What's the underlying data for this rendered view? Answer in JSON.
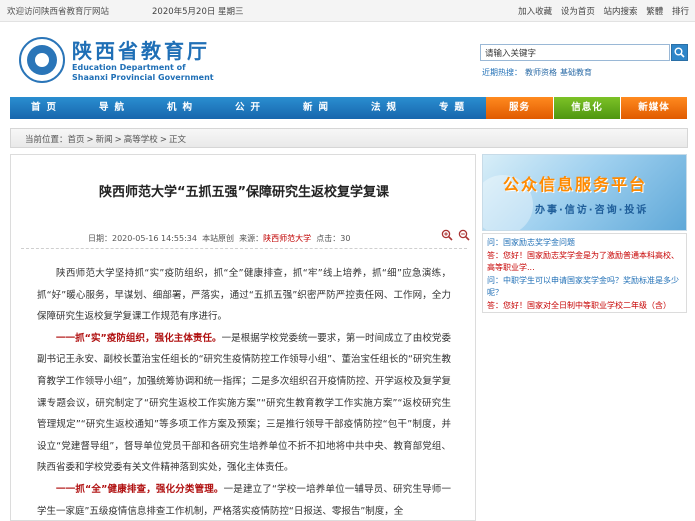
{
  "topbar": {
    "welcome": "欢迎访问陕西省教育厅网站",
    "date": "2020年5月20日 星期三",
    "links": [
      "加入收藏",
      "设为首页",
      "站内搜索",
      "繁體",
      "排行"
    ]
  },
  "header": {
    "title_cn": "陕西省教育厅",
    "title_en_line1": "Education Department of",
    "title_en_line2": "Shaanxi Provincial Government",
    "search_placeholder": "请输入关键字",
    "hot_label": "近期热搜：",
    "hot_keywords": [
      "教师资格",
      "基础教育"
    ]
  },
  "nav": {
    "items": [
      "首页",
      "导航",
      "机构",
      "公开",
      "新闻",
      "法规",
      "专题",
      "服务",
      "信息化",
      "新媒体"
    ]
  },
  "breadcrumb": {
    "label": "当前位置：",
    "items": [
      "首页",
      "新闻",
      "高等学校",
      "正文"
    ]
  },
  "article": {
    "title": "陕西师范大学“五抓五强”保障研究生返校复学复课",
    "meta_date": "日期：2020-05-16 14:55:34",
    "meta_type": "本站原创",
    "meta_source_label": "来源：",
    "meta_source": "陕西师范大学",
    "meta_views": "点击：30",
    "para1": "陕西师范大学坚持抓“实”疫防组织，抓“全”健康排查，抓“牢”线上培养，抓“细”应急演练，抓“好”暖心服务，早谋划、细部署，严落实，通过“五抓五强”织密严防严控责任网、工作网，全力保障研究生返校复学复课工作规范有序进行。",
    "para2_bold": "一一抓“实”疫防组织，强化主体责任。",
    "para2_rest": "一是根据学校党委统一要求，第一时间成立了由校党委副书记王永安、副校长董治宝任组长的“研究生疫情防控工作领导小组”、董治宝任组长的“研究生教育教学工作领导小组”，加强统筹协调和统一指挥；二是多次组织召开疫情防控、开学返校及复学复课专题会议，研究制定了“研究生返校工作实施方案”“研究生教育教学工作实施方案”“返校研究生管理规定”“研究生返校通知”等多项工作方案及预案；三是推行领导干部疫情防控“包干”制度，并设立“党建督导组”，督导单位党员干部和各研究生培养单位不折不扣地将中共中央、教育部党组、陕西省委和学校党委有关文件精神落到实处，强化主体责任。",
    "para3_bold": "一一抓“全”健康排查，强化分类管理。",
    "para3_rest": "一是建立了“学校一培养单位一辅导员、研究生导师一学生一家庭”五级疫情信息排查工作机制，严格落实疫情防控“日报送、零报告”制度，全"
  },
  "sidebar": {
    "banner_title": "公众信息服务平台",
    "banner_sub": "办事·信访·咨询·投诉",
    "qa": [
      {
        "q": "问：国家励志奖学金问题",
        "a": "答：您好！国家励志奖学金是为了激励普通本科高校、高等职业学..."
      },
      {
        "q": "问：中职学生可以申请国家奖学金吗？奖励标准是多少呢？",
        "a": "答：您好！国家对全日制中等职业学校二年级（含）"
      }
    ]
  },
  "colors": {
    "brand_blue": "#1f6fb6",
    "nav_blue": "#1766ad",
    "nav_orange": "#e05a00",
    "nav_green": "#4f9610",
    "accent_red": "#c00000"
  }
}
